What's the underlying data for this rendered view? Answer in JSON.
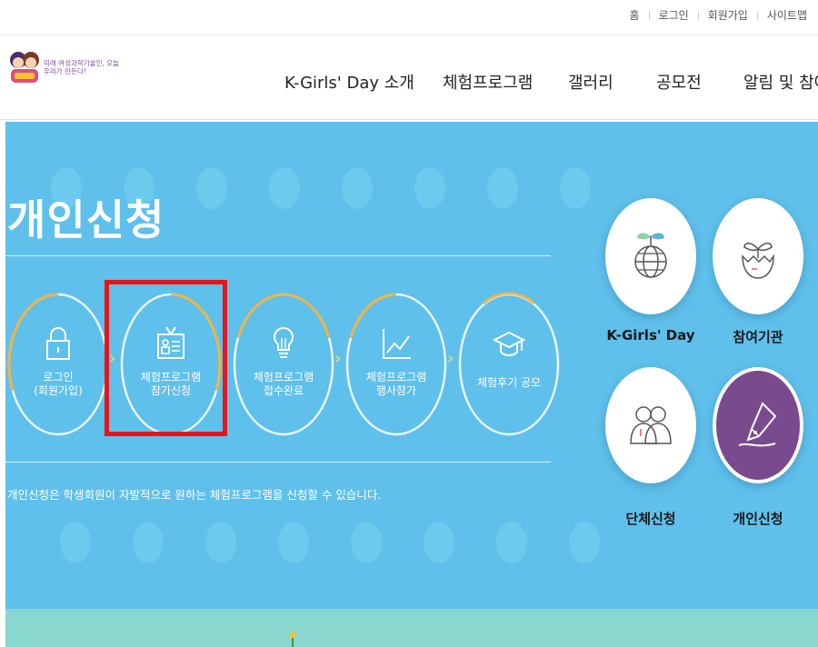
{
  "utility": {
    "links": [
      "홈",
      "로그인",
      "회원가입",
      "사이트맵"
    ]
  },
  "header": {
    "logo_alt": "K-Girls' Day",
    "logo_slogan_1": "미래 여성과학기술인, 오늘",
    "logo_slogan_2": "우리가 만든다!",
    "nav": [
      "K-Girls' Day 소개",
      "체험프로그램",
      "갤러리",
      "공모전",
      "알림 및 참여"
    ]
  },
  "hero": {
    "title": "개인신청",
    "steps": [
      {
        "label": "로그인\n(회원가입)",
        "icon": "lock-icon"
      },
      {
        "label": "체험프로그램\n참가신청",
        "icon": "id-card-icon"
      },
      {
        "label": "체험프로그램\n접수완료",
        "icon": "lightbulb-icon"
      },
      {
        "label": "체험프로그램\n행사참가",
        "icon": "chart-line-icon"
      },
      {
        "label": "체험후기 공모",
        "icon": "graduation-cap-icon"
      }
    ],
    "description": "개인신청은 학생회원이 자발적으로 원하는 체험프로그램을 신청할 수 있습니다.",
    "side_menu": [
      {
        "label": "K-Girls' Day",
        "icon": "globe-sprout-icon"
      },
      {
        "label": "참여기관",
        "icon": "eggshell-sprout-icon"
      },
      {
        "label": "단체신청",
        "icon": "group-people-icon"
      },
      {
        "label": "개인신청",
        "icon": "pen-nib-icon"
      }
    ]
  },
  "colors": {
    "hero_bg": "#5fc0eb",
    "accent": "#f0b545",
    "active_badge": "#7a4a8e",
    "highlight": "#e5151b",
    "bottom_band": "#8ad7d0"
  }
}
